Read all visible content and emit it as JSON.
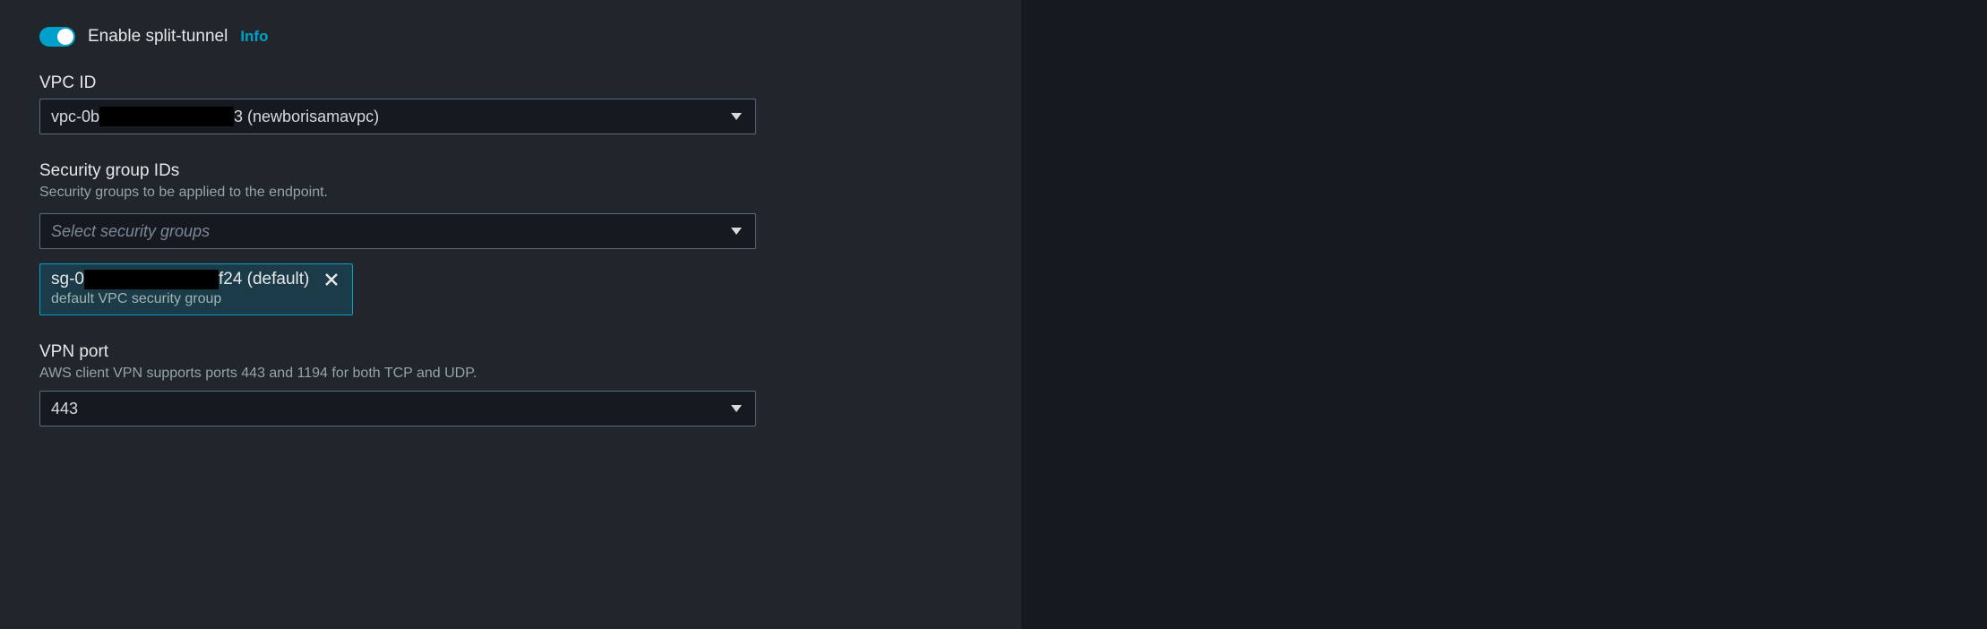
{
  "splitTunnel": {
    "label": "Enable split-tunnel",
    "infoLabel": "Info",
    "enabled": true
  },
  "vpc": {
    "label": "VPC ID",
    "selectedPrefix": "vpc-0b",
    "selectedSuffix": "3 (newborisamavpc)"
  },
  "securityGroups": {
    "label": "Security group IDs",
    "description": "Security groups to be applied to the endpoint.",
    "placeholder": "Select security groups",
    "selected": {
      "idPrefix": "sg-0",
      "idSuffix": "f24 (default)",
      "description": "default VPC security group"
    }
  },
  "vpnPort": {
    "label": "VPN port",
    "description": "AWS client VPN supports ports 443 and 1194 for both TCP and UDP.",
    "selected": "443"
  }
}
